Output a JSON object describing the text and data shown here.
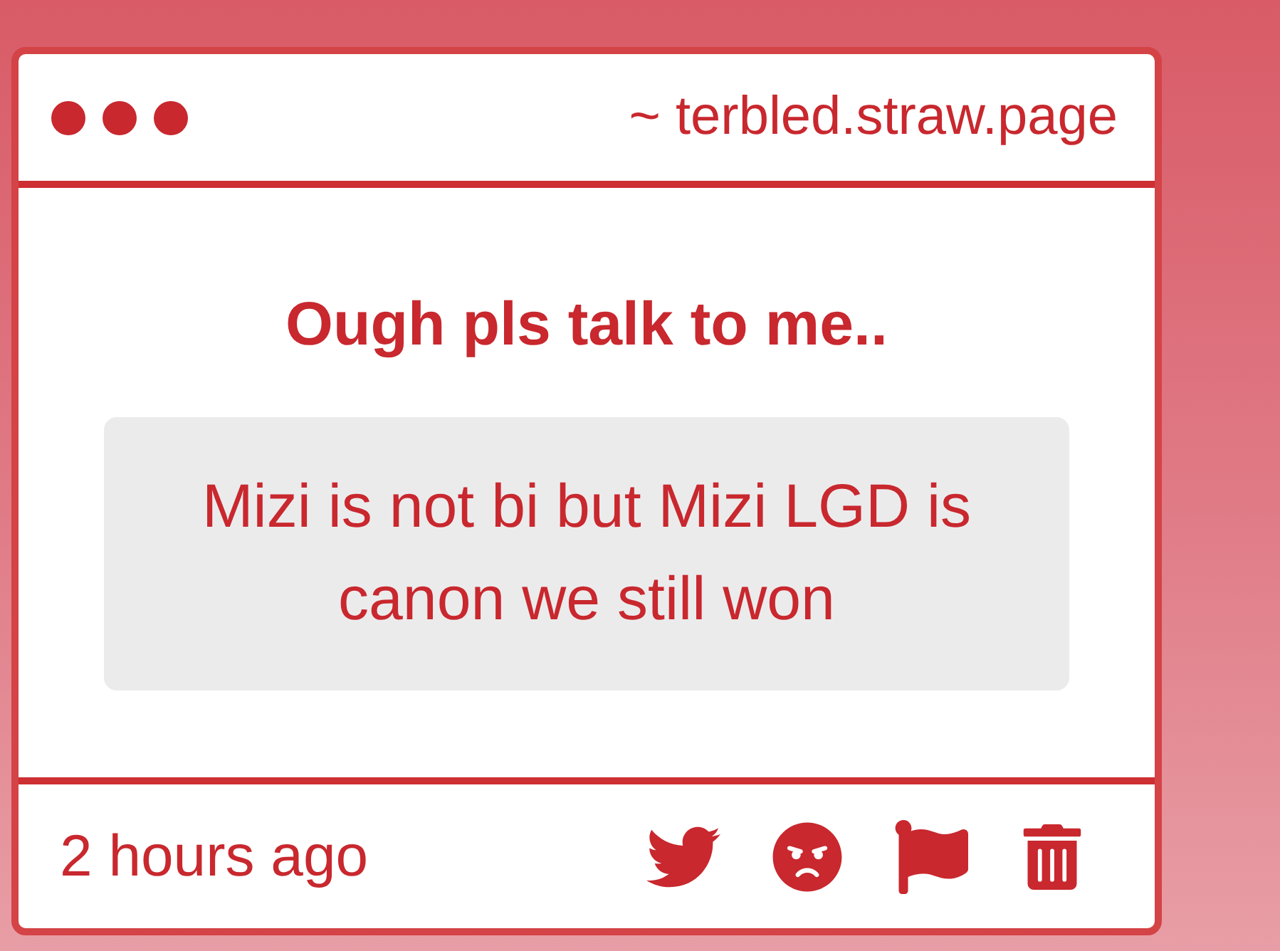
{
  "window": {
    "url": "~ terbled.straw.page"
  },
  "post": {
    "title": "Ough pls talk to me..",
    "message": "Mizi is not bi but Mizi LGD is canon we still won"
  },
  "footer": {
    "time": "2 hours ago",
    "actions": [
      {
        "kind": "twitter"
      },
      {
        "kind": "angry"
      },
      {
        "kind": "flag"
      },
      {
        "kind": "delete"
      }
    ]
  }
}
